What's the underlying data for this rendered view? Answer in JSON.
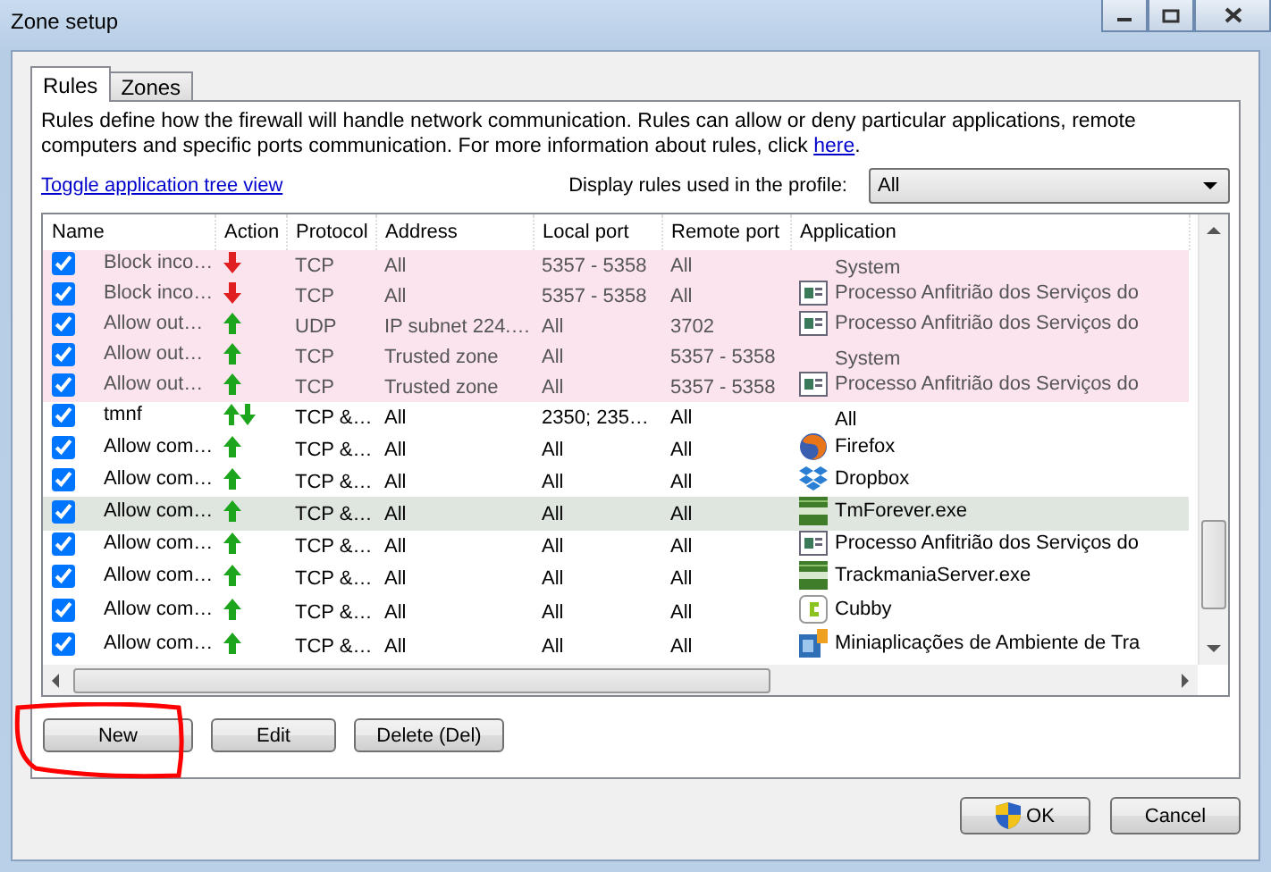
{
  "window": {
    "title": "Zone setup"
  },
  "tabs": [
    {
      "label": "Rules",
      "selected": true
    },
    {
      "label": "Zones",
      "selected": false
    }
  ],
  "description": {
    "text": "Rules define how the firewall will handle network communication. Rules can allow or deny particular applications, remote computers and specific ports communication. For more information about rules, click ",
    "link": "here",
    "end": "."
  },
  "toggle_link": "Toggle application tree view",
  "profile": {
    "label": "Display rules used in the profile:",
    "value": "All"
  },
  "table": {
    "columns": [
      "Name",
      "Action",
      "Protocol",
      "Address",
      "Local port",
      "Remote port",
      "Application"
    ],
    "rows": [
      {
        "checked": true,
        "locked": true,
        "selected": false,
        "name": "Block inco…",
        "action": {
          "kind": "block"
        },
        "protocol": "TCP",
        "address": "All",
        "local_port": "5357 - 5358",
        "remote_port": "All",
        "application": {
          "kind": "none",
          "text": "System"
        }
      },
      {
        "checked": true,
        "locked": true,
        "selected": false,
        "name": "Block inco…",
        "action": {
          "kind": "block"
        },
        "protocol": "TCP",
        "address": "All",
        "local_port": "5357 - 5358",
        "remote_port": "All",
        "application": {
          "kind": "service",
          "text": "Processo Anfitrião dos Serviços do"
        }
      },
      {
        "checked": true,
        "locked": true,
        "selected": false,
        "name": "Allow out…",
        "action": {
          "kind": "allow"
        },
        "protocol": "UDP",
        "address": "IP subnet 224.…",
        "local_port": "All",
        "remote_port": "3702",
        "application": {
          "kind": "service",
          "text": "Processo Anfitrião dos Serviços do"
        }
      },
      {
        "checked": true,
        "locked": true,
        "selected": false,
        "name": "Allow out…",
        "action": {
          "kind": "allow"
        },
        "protocol": "TCP",
        "address": "Trusted zone",
        "local_port": "All",
        "remote_port": "5357 - 5358",
        "application": {
          "kind": "none",
          "text": "System"
        }
      },
      {
        "checked": true,
        "locked": true,
        "selected": false,
        "name": "Allow out…",
        "action": {
          "kind": "allow"
        },
        "protocol": "TCP",
        "address": "Trusted zone",
        "local_port": "All",
        "remote_port": "5357 - 5358",
        "application": {
          "kind": "service",
          "text": "Processo Anfitrião dos Serviços do"
        }
      },
      {
        "checked": true,
        "locked": false,
        "selected": false,
        "name": "tmnf",
        "action": {
          "kind": "both"
        },
        "protocol": "TCP &…",
        "address": "All",
        "local_port": "2350; 235…",
        "remote_port": "All",
        "application": {
          "kind": "none",
          "text": "All"
        }
      },
      {
        "checked": true,
        "locked": false,
        "selected": false,
        "name": "Allow com…",
        "action": {
          "kind": "allow"
        },
        "protocol": "TCP &…",
        "address": "All",
        "local_port": "All",
        "remote_port": "All",
        "application": {
          "kind": "browser",
          "text": "Firefox"
        }
      },
      {
        "checked": true,
        "locked": false,
        "selected": false,
        "name": "Allow com…",
        "action": {
          "kind": "allow"
        },
        "protocol": "TCP &…",
        "address": "All",
        "local_port": "All",
        "remote_port": "All",
        "application": {
          "kind": "boxes",
          "text": "Dropbox"
        }
      },
      {
        "checked": true,
        "locked": false,
        "selected": true,
        "name": "Allow com…",
        "action": {
          "kind": "allow"
        },
        "protocol": "TCP &…",
        "address": "All",
        "local_port": "All",
        "remote_port": "All",
        "application": {
          "kind": "game",
          "text": "TmForever.exe"
        }
      },
      {
        "checked": true,
        "locked": false,
        "selected": false,
        "name": "Allow com…",
        "action": {
          "kind": "allow"
        },
        "protocol": "TCP &…",
        "address": "All",
        "local_port": "All",
        "remote_port": "All",
        "application": {
          "kind": "service",
          "text": "Processo Anfitrião dos Serviços do"
        }
      },
      {
        "checked": true,
        "locked": false,
        "selected": false,
        "name": "Allow com…",
        "action": {
          "kind": "allow"
        },
        "protocol": "TCP &…",
        "address": "All",
        "local_port": "All",
        "remote_port": "All",
        "application": {
          "kind": "game",
          "text": "TrackmaniaServer.exe"
        }
      },
      {
        "checked": true,
        "locked": false,
        "selected": false,
        "name": "Allow com…",
        "action": {
          "kind": "allow"
        },
        "protocol": "TCP &…",
        "address": "All",
        "local_port": "All",
        "remote_port": "All",
        "application": {
          "kind": "cube",
          "text": "Cubby"
        }
      },
      {
        "checked": true,
        "locked": false,
        "selected": false,
        "name": "Allow com…",
        "action": {
          "kind": "allow"
        },
        "protocol": "TCP &…",
        "address": "All",
        "local_port": "All",
        "remote_port": "All",
        "application": {
          "kind": "gadget",
          "text": "Miniaplicações de Ambiente de Tra"
        }
      }
    ]
  },
  "buttons": [
    {
      "label": "New",
      "circled": true
    },
    {
      "label": "Edit",
      "circled": false
    },
    {
      "label": "Delete (Del)",
      "circled": false
    }
  ],
  "footer_buttons": [
    {
      "label": "OK",
      "shield": true
    },
    {
      "label": "Cancel",
      "shield": false
    }
  ]
}
